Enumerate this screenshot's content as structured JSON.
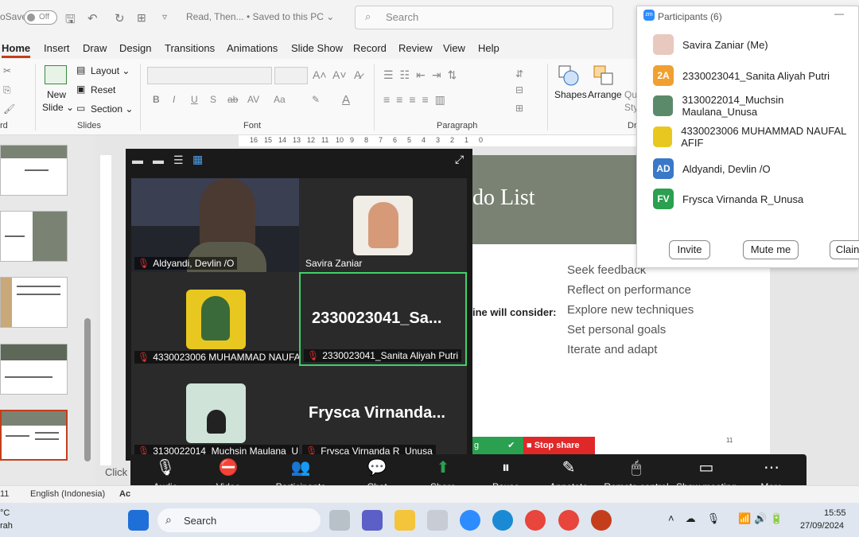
{
  "titlebar": {
    "autosave_label": "oSave",
    "toggle_label": "Off",
    "doc_title": "Read, Then...",
    "saved_status": "• Saved to this PC ⌄",
    "search_placeholder": "Search"
  },
  "menu": [
    "Home",
    "Insert",
    "Draw",
    "Design",
    "Transitions",
    "Animations",
    "Slide Show",
    "Record",
    "Review",
    "View",
    "Help"
  ],
  "ribbon": {
    "new_slide": "New",
    "new_slide2": "Slide ⌄",
    "layout": "Layout ⌄",
    "reset": "Reset",
    "section": "Section ⌄",
    "slides_group": "Slides",
    "font_group": "Font",
    "paragraph_group": "Paragraph",
    "clipboard_group": "rd",
    "shapes": "Shapes",
    "arrange": "Arrange",
    "quick_styles": "Qu",
    "quick_styles2": "Sty",
    "drawing_group": "Dr",
    "font_buttons": [
      "B",
      "I",
      "U",
      "S",
      "ab",
      "AV",
      "Aa"
    ]
  },
  "ruler_numbers": [
    "16",
    "15",
    "14",
    "13",
    "12",
    "11",
    "10",
    "9",
    "8",
    "7",
    "6",
    "5",
    "4",
    "3",
    "2",
    "1",
    "0"
  ],
  "slide": {
    "title_fragment": "do List",
    "body_fragment": "ine will consider:",
    "items": [
      "Seek feedback",
      "Reflect on performance",
      "Explore new techniques",
      "Set personal goals",
      "Iterate and adapt"
    ],
    "page_number": "11"
  },
  "zoom": {
    "tiles": [
      {
        "name": "Aldyandi, Devlin /O"
      },
      {
        "name": "Savira Zaniar"
      },
      {
        "name": "4330023006 MUHAMMAD NAUFA..."
      },
      {
        "name": "2330023041_Sanita Aliyah Putri",
        "big": "2330023041_Sa..."
      },
      {
        "name": "3130022014_Muchsin Maulana_U..."
      },
      {
        "name": "Frysca Virnanda R_Unusa",
        "big": "Frysca  Virnanda..."
      }
    ],
    "share_fragment": "g",
    "stop_share": "Stop share",
    "toolbar": [
      "Audio",
      "Video",
      "Participants",
      "Chat",
      "Share",
      "Pause",
      "Annotate",
      "Remote control",
      "Show meeting",
      "More"
    ]
  },
  "participants": {
    "title": "Participants (6)",
    "list": [
      {
        "name": "Savira Zaniar (Me)",
        "initials": "",
        "color": "#e9c8c0"
      },
      {
        "name": "2330023041_Sanita Aliyah Putri",
        "initials": "2A",
        "color": "#f0a030"
      },
      {
        "name": "3130022014_Muchsin Maulana_Unusa",
        "initials": "",
        "color": "#5a8a6a"
      },
      {
        "name": "4330023006 MUHAMMAD NAUFAL AFIF",
        "initials": "",
        "color": "#e8c820"
      },
      {
        "name": "Aldyandi, Devlin /O",
        "initials": "AD",
        "color": "#3a78c8"
      },
      {
        "name": "Frysca Virnanda R_Unusa",
        "initials": "FV",
        "color": "#2aa050"
      }
    ],
    "invite": "Invite",
    "mute_me": "Mute me",
    "claim": "Clain"
  },
  "statusbar": {
    "slide_num": "11",
    "language": "English (Indonesia)",
    "accessibility": "Ac",
    "click_text": "Click"
  },
  "taskbar": {
    "search": "Search",
    "time": "15:55",
    "date": "27/09/2024",
    "weather_temp": "°C",
    "weather_desc": "rah"
  }
}
